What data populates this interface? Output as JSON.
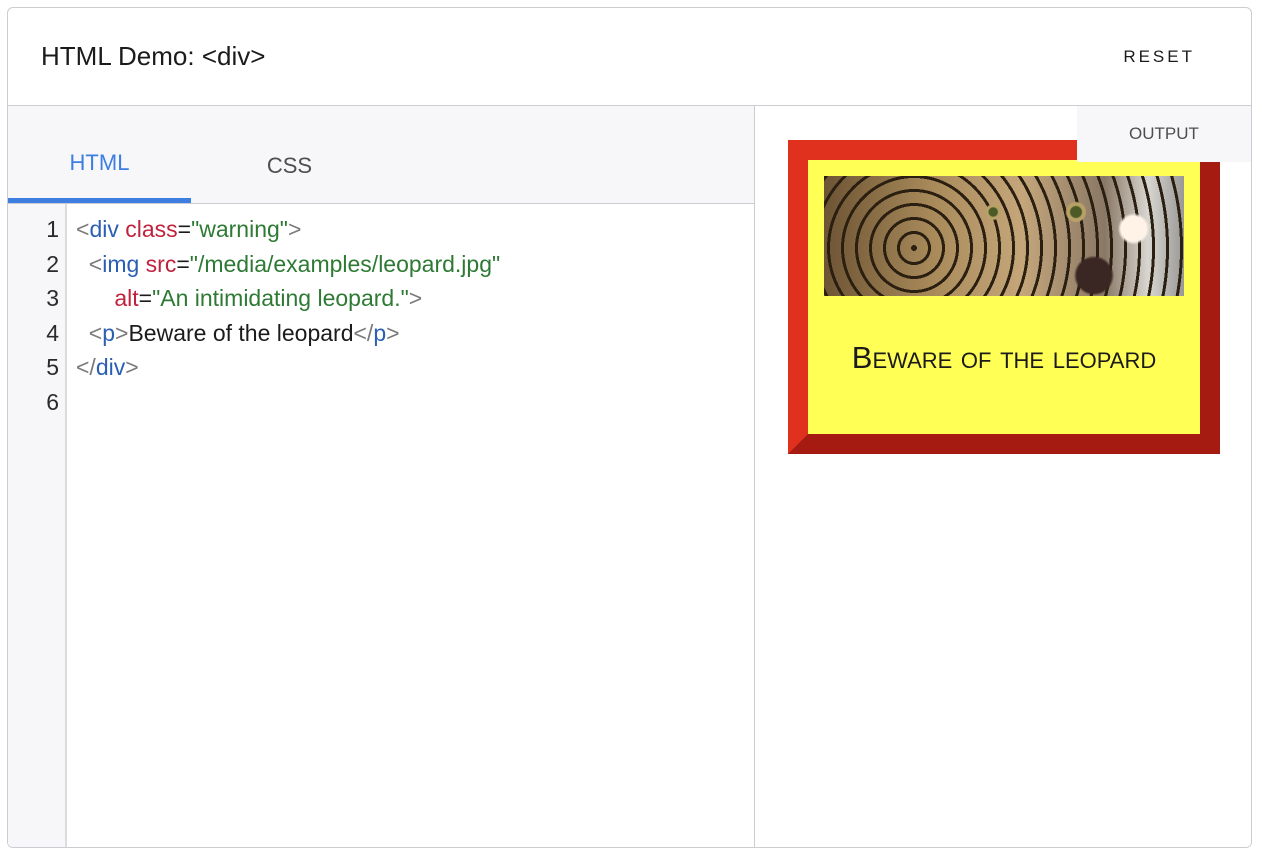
{
  "header": {
    "title": "HTML Demo: <div>",
    "reset_label": "RESET"
  },
  "editor": {
    "tabs": [
      {
        "label": "HTML",
        "active": true
      },
      {
        "label": "CSS",
        "active": false
      }
    ],
    "line_numbers": [
      "1",
      "2",
      "3",
      "4",
      "5",
      "6"
    ],
    "code": {
      "l1_open": "<",
      "l1_tag": "div",
      "l1_attr": "class",
      "l1_eq": "=",
      "l1_val": "\"warning\"",
      "l1_close": ">",
      "l2_indent": "  ",
      "l2_open": "<",
      "l2_tag": "img",
      "l2_attr": "src",
      "l2_eq": "=",
      "l2_val": "\"/media/examples/leopard.jpg\"",
      "l3_indent": "      ",
      "l3_attr": "alt",
      "l3_eq": "=",
      "l3_val": "\"An intimidating leopard.\"",
      "l3_close": ">",
      "l4_indent": "  ",
      "l4_open": "<",
      "l4_tag": "p",
      "l4_close": ">",
      "l4_text": "Beware of the leopard",
      "l4_end_open": "</",
      "l4_end_tag": "p",
      "l4_end_close": ">",
      "l5_open": "</",
      "l5_tag": "div",
      "l5_close": ">"
    }
  },
  "output": {
    "label": "OUTPUT",
    "image_alt": "An intimidating leopard.",
    "paragraph": "Beware of the leopard",
    "colors": {
      "box_background": "#ffff55",
      "border_light": "#e0301e",
      "border_dark": "#a61b11"
    }
  },
  "colors": {
    "accent": "#3d7ee0",
    "tag": "#2b5fb4",
    "attr": "#c0223c",
    "value": "#2e7a34"
  }
}
